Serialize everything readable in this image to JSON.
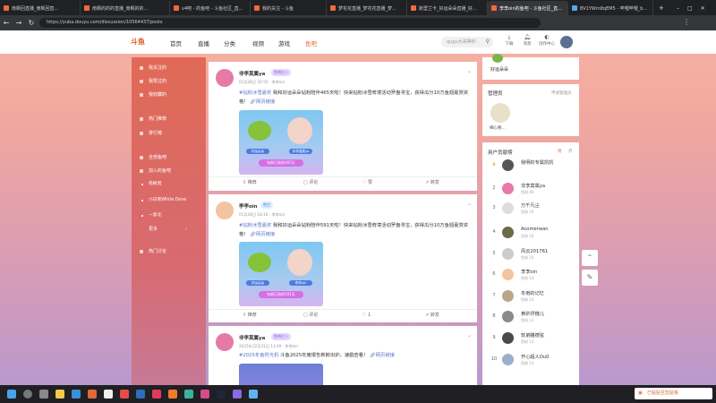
{
  "browser": {
    "tabs": [
      "南枫回直播_南枫回直...",
      "南枫的的的直播_南枫的的...",
      "v4吧 - 的鱼吧 - 斗鱼社区_直...",
      "我的关注 - 斗鱼",
      "梦花花直播_梦花花直播_梦...",
      "斯里兰卡_好运朵朵直播_好...",
      "李李oin的鱼吧 - 斗鱼社区_直...",
      "BV1YWm8qEM5 - 哔哩哔哩_b..."
    ],
    "url": "https://yuba.douyu.com/discussion/10564437/posts"
  },
  "site": {
    "logo": "斗鱼",
    "nav": [
      "首页",
      "直播",
      "分类",
      "视频",
      "游戏",
      "鱼吧"
    ],
    "search_placeholder": "qugu大哥等你",
    "header_icons": [
      "下载",
      "消息",
      "创作中心"
    ]
  },
  "left_menu": {
    "items": [
      "我关注的",
      "我赞过的",
      "我收藏的",
      "热门推荐",
      "排行榜",
      "全部鱼吧",
      "加入的鱼吧"
    ],
    "sub_items": [
      "南枫回",
      "小白熊White Dove",
      "一意北"
    ],
    "more": "更多",
    "last": "热门讨论"
  },
  "posts": [
    {
      "author": "非李莫属ya",
      "badge": "鱼吧红人",
      "time": "01月28日 20:50",
      "sub": "李李oin",
      "tag": "#钻粉冰雪嘉奖",
      "text": "我和好运朵朵钻粉陪伴465天啦！快来钻粉冰雪奇境活动罗盘寻宝，获得瓜分10万鱼翅嘉赏资格！",
      "link": "网页链接",
      "img_tags": [
        "好运朵朵",
        "非李莫属ya"
      ],
      "img_bar": "钻粉已陪伴465天",
      "actions": [
        {
          "icon": "share-icon",
          "label": "推荐"
        },
        {
          "icon": "comment-icon",
          "label": "评论"
        },
        {
          "icon": "like-icon",
          "label": "赞"
        },
        {
          "icon": "forward-icon",
          "label": "转发"
        }
      ]
    },
    {
      "author": "李李oin",
      "badge": "吧主",
      "time": "01月28日 18:10",
      "sub": "李李oin",
      "tag": "#钻粉冰雪嘉奖",
      "text": "我和好运朵朵钻粉陪伴591天啦！快来钻粉冰雪奇境活动罗盘寻宝，获得瓜分10万鱼翅嘉赏资格！",
      "link": "网页链接",
      "img_tags": [
        "好运朵朵",
        "李李oin"
      ],
      "img_bar": "钻粉已陪伴591天",
      "actions": [
        {
          "icon": "share-icon",
          "label": "推荐"
        },
        {
          "icon": "comment-icon",
          "label": "评论"
        },
        {
          "icon": "like-icon",
          "label": "1"
        },
        {
          "icon": "forward-icon",
          "label": "转发"
        }
      ]
    },
    {
      "author": "非李莫属ya",
      "badge": "鱼吧红人",
      "time": "2025年12月31日 13:49",
      "sub": "李李oin",
      "tag": "#2025年鱼时光机",
      "text": "斗鱼2025年度报告新鲜出炉，速戳查看！",
      "link": "网页链接"
    }
  ],
  "right": {
    "streamer_name": "好运朵朵",
    "admins_title": "管理员",
    "admins_manage": "申请管理员",
    "admin_name": "细心略...",
    "board_title": "用户贡献榜",
    "board_tabs": [
      "周",
      "月"
    ],
    "users": [
      {
        "rank": "",
        "name": "我明的专属凯凯",
        "lv": ""
      },
      {
        "rank": "2",
        "name": "非李莫属ya",
        "lv": "鱼粉 46"
      },
      {
        "rank": "3",
        "name": "万千凡尘",
        "lv": "鱼粉 16"
      },
      {
        "rank": "4",
        "name": "Acomerwan",
        "lv": "鱼粉 16"
      },
      {
        "rank": "5",
        "name": "风云201761",
        "lv": "鱼粉 14"
      },
      {
        "rank": "6",
        "name": "李李oin",
        "lv": "鱼粉 14"
      },
      {
        "rank": "7",
        "name": "冬雨的记忆",
        "lv": "鱼粉 14"
      },
      {
        "rank": "8",
        "name": "黄砂抒楷儿",
        "lv": "鱼粉 13"
      },
      {
        "rank": "9",
        "name": "软弟瞄德弦",
        "lv": "鱼粉 13"
      },
      {
        "rank": "10",
        "name": "开心超人Ou0",
        "lv": "鱼粉 13"
      }
    ]
  },
  "notification": "已粘贴至剪贴板"
}
